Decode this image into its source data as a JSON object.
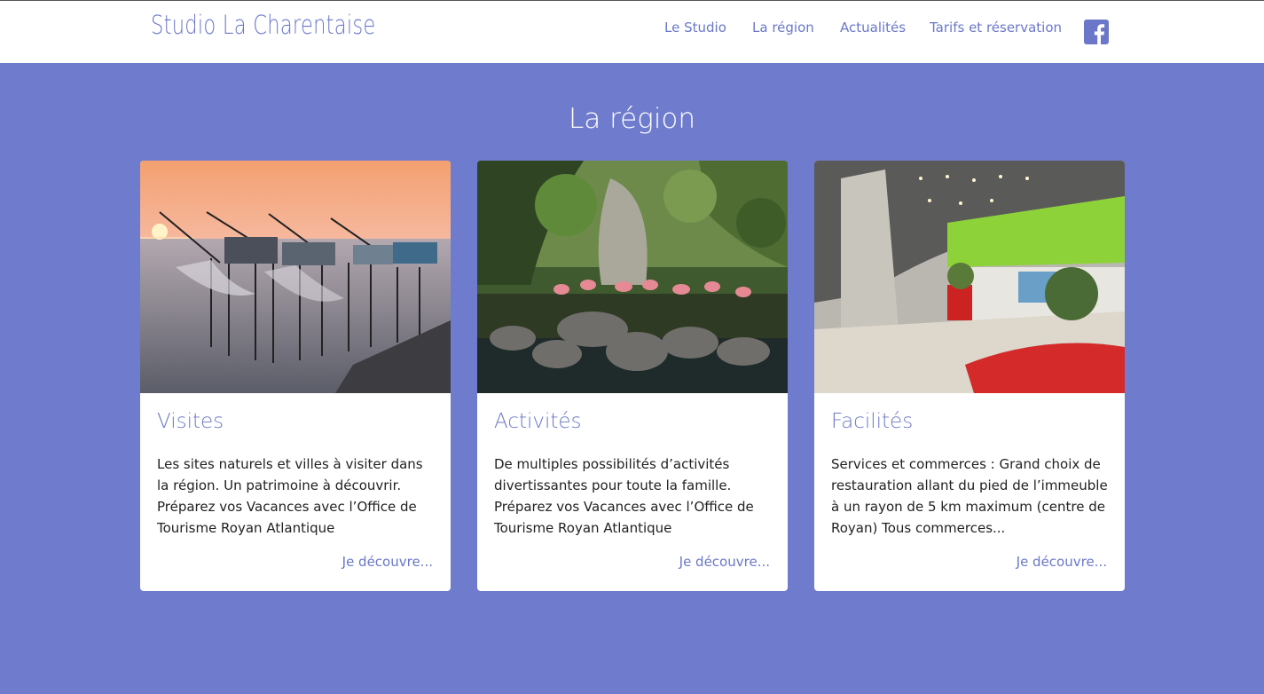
{
  "header": {
    "logo": "Studio La Charentaise",
    "nav": [
      "Le Studio",
      "La région",
      "Actualités",
      "Tarifs et réservation"
    ],
    "facebook_icon": "facebook-icon"
  },
  "main": {
    "title": "La région",
    "cards": [
      {
        "title": "Visites",
        "text": "Les sites naturels et villes à visiter dans la région. Un patrimoine à découvrir. Préparez vos Vacances avec l’Office de Tourisme Royan Atlantique",
        "link": "Je découvre..."
      },
      {
        "title": "Activités",
        "text": "De multiples possibilités d’activités divertissantes pour toute la famille. Préparez vos Vacances avec l’Office de Tourisme Royan Atlantique",
        "link": "Je découvre..."
      },
      {
        "title": "Facilités",
        "text": "Services et commerces : Grand choix de restauration allant du pied de l’immeuble à un rayon de 5 km maximum (centre de Royan) Tous commerces...",
        "link": "Je découvre..."
      }
    ]
  },
  "colors": {
    "background": "#6f7ccd",
    "accent": "#6b78c9",
    "card": "#ffffff"
  }
}
